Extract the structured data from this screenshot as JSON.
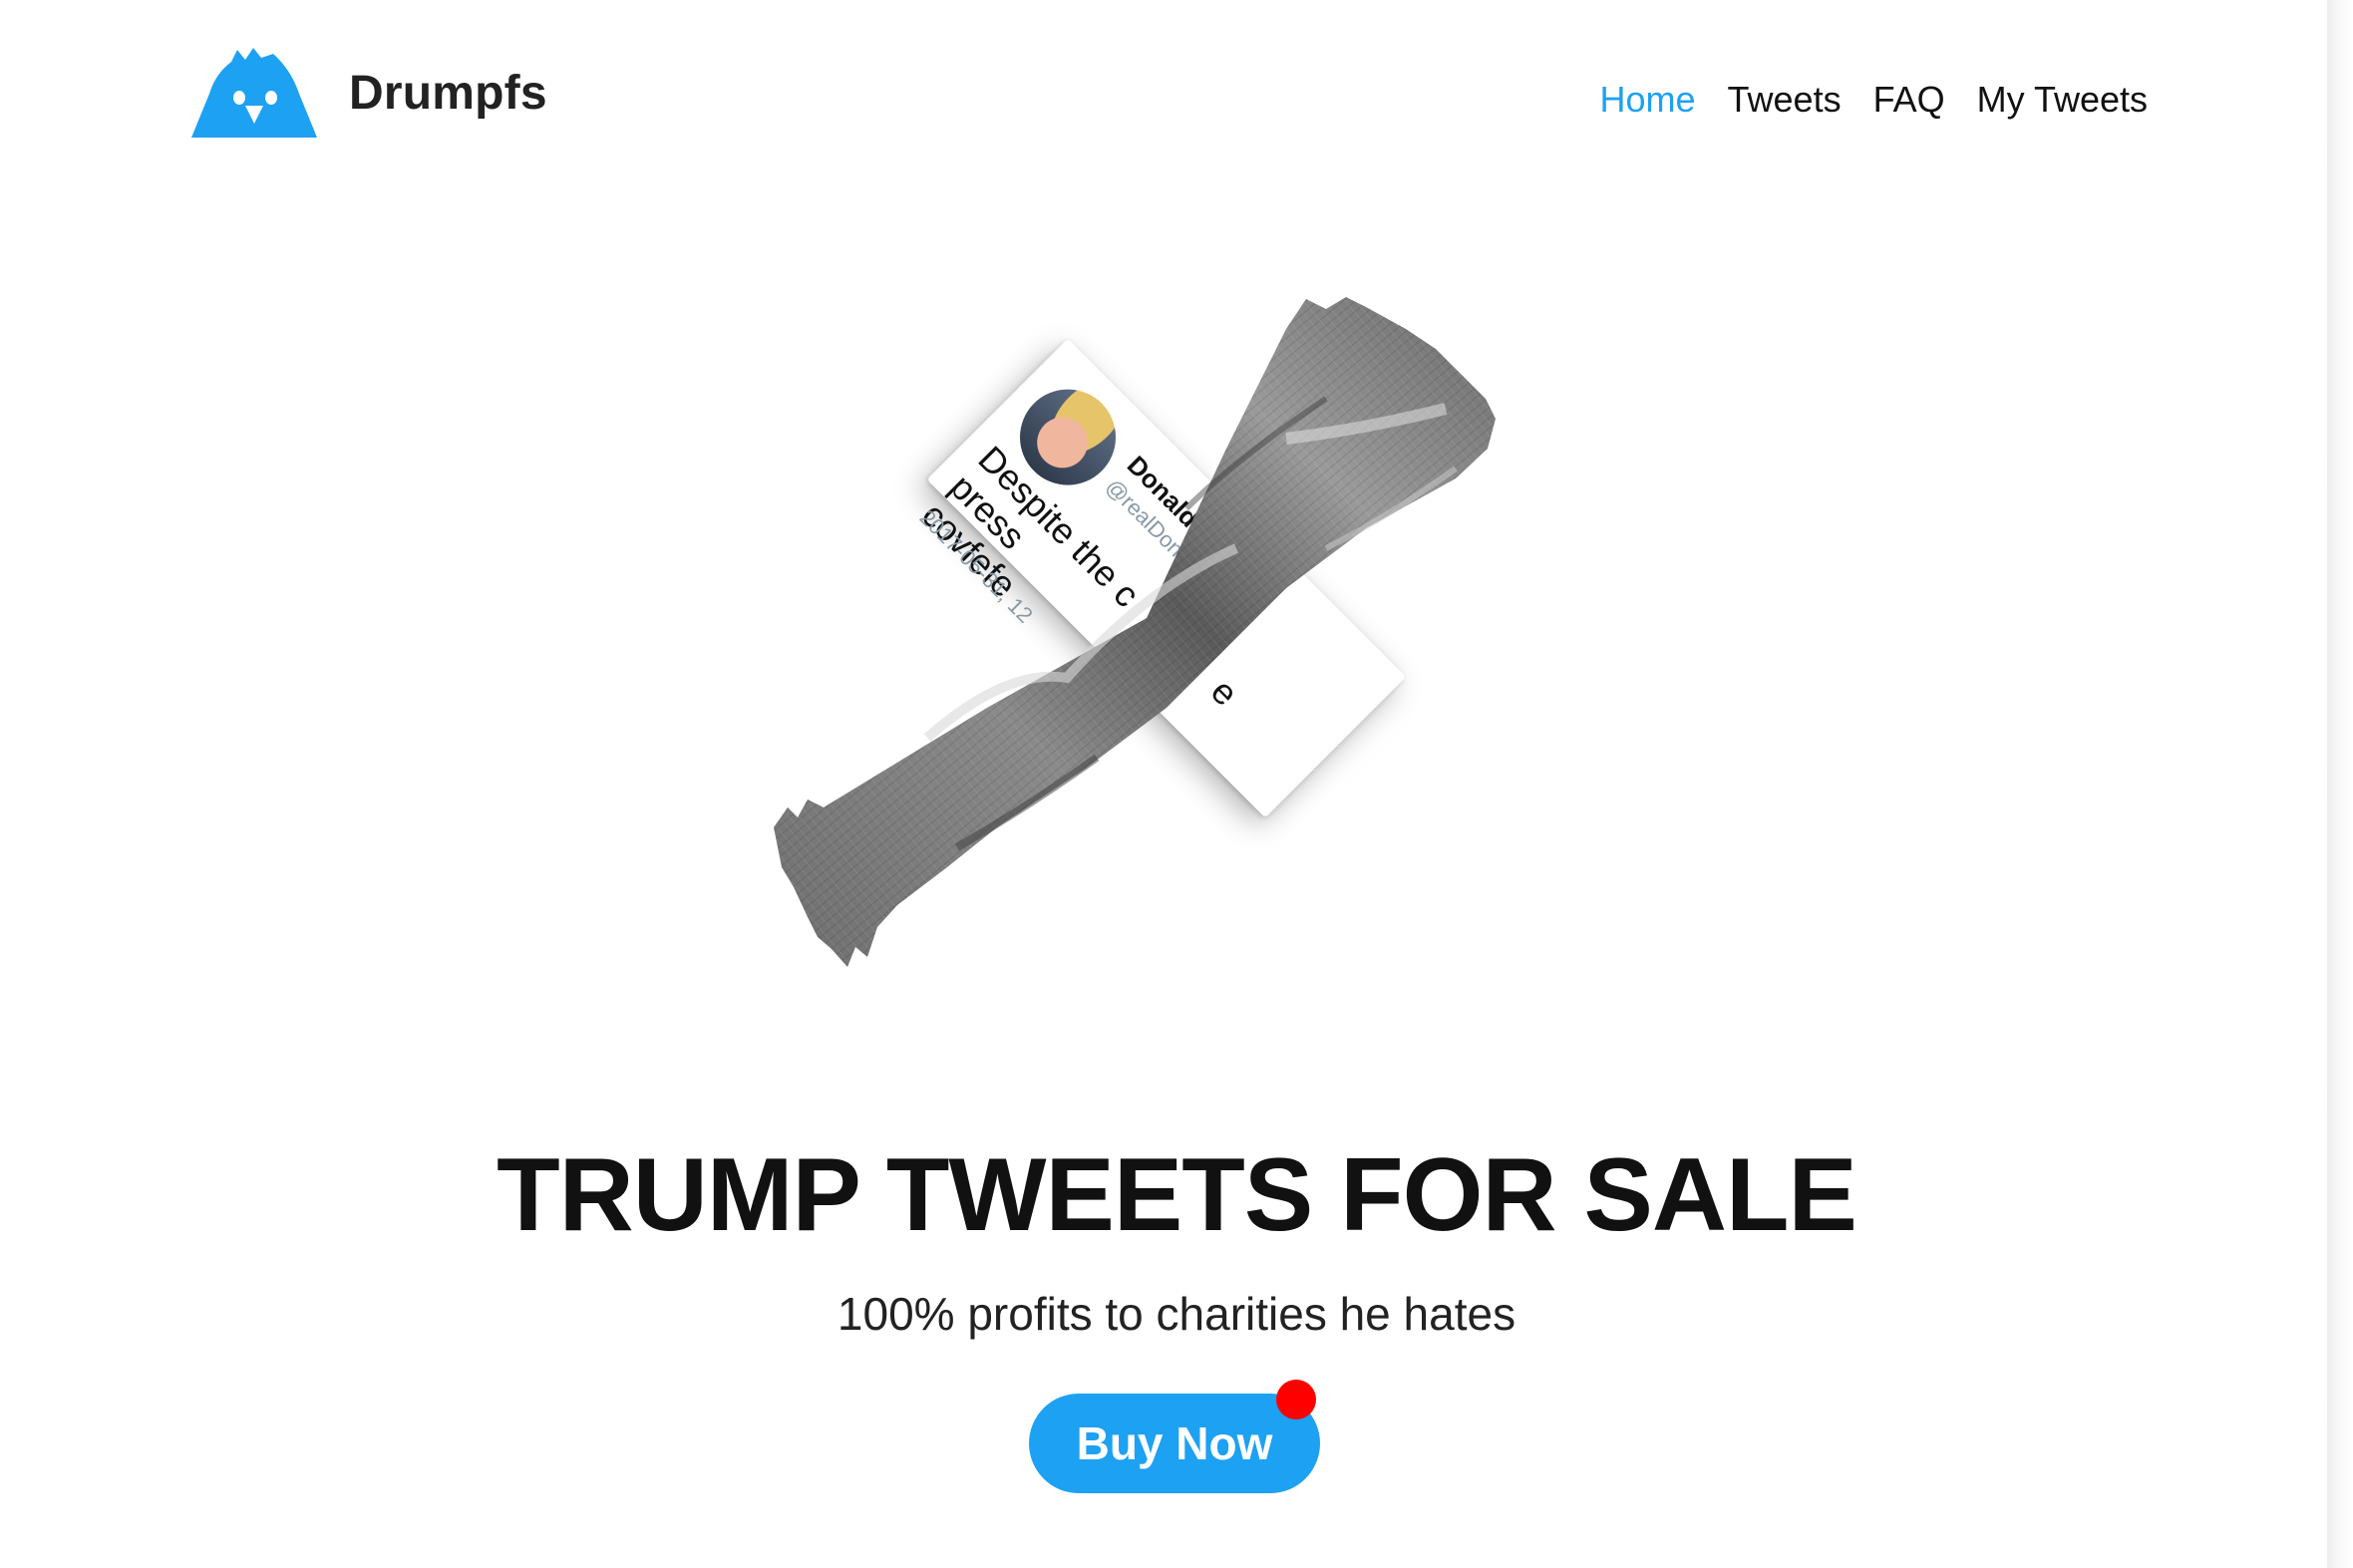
{
  "brand": {
    "name": "Drumpfs",
    "logo_icon": "bird-logo-icon",
    "accent": "#1da1f2"
  },
  "nav": {
    "items": [
      {
        "label": "Home",
        "active": true
      },
      {
        "label": "Tweets",
        "active": false
      },
      {
        "label": "FAQ",
        "active": false
      },
      {
        "label": "My Tweets",
        "active": false
      }
    ]
  },
  "hero": {
    "tweet": {
      "name": "Donald J. T",
      "handle": "@realDona",
      "text": "Despite the c... e press covfefe",
      "text_lead": "Despite the c",
      "text_tail": "e press",
      "text_line2": "covfefe",
      "date": "2017-05-31, 12"
    }
  },
  "headline": "TRUMP TWEETS FOR SALE",
  "subheadline": "100% profits to charities he hates",
  "cta": {
    "label": "Buy Now",
    "notification_color": "#ff0000"
  }
}
